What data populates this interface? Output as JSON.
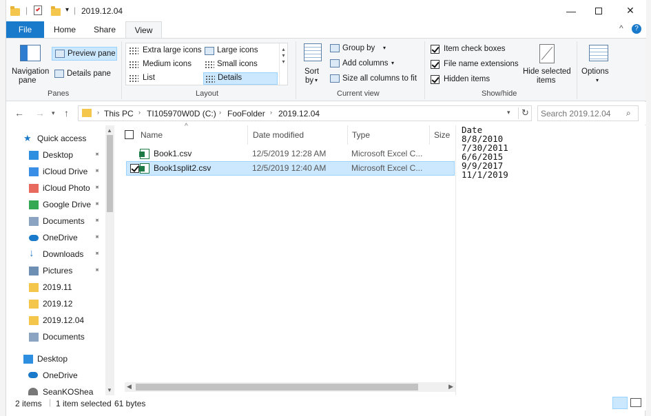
{
  "window": {
    "title": "2019.12.04",
    "qat_dropdown": "▾"
  },
  "tabs": [
    "File",
    "Home",
    "Share",
    "View"
  ],
  "ribbon": {
    "panes": {
      "navigation_pane": "Navigation",
      "navigation_pane_2": "pane",
      "preview_pane": "Preview pane",
      "details_pane": "Details pane",
      "group_label": "Panes"
    },
    "layout": {
      "items": [
        "Extra large icons",
        "Large icons",
        "Medium icons",
        "Small icons",
        "List",
        "Details"
      ],
      "group_label": "Layout"
    },
    "current_view": {
      "sort_by": "Sort",
      "sort_by_2": "by",
      "group_by": "Group by",
      "add_columns": "Add columns",
      "size_all": "Size all columns to fit",
      "group_label": "Current view"
    },
    "show_hide": {
      "item_check_boxes": "Item check boxes",
      "file_name_extensions": "File name extensions",
      "hidden_items": "Hidden items",
      "hide_selected": "Hide selected",
      "hide_selected_2": "items",
      "group_label": "Show/hide"
    },
    "options": "Options"
  },
  "address": {
    "crumbs": [
      "This PC",
      "TI105970W0D (C:)",
      "FooFolder",
      "2019.12.04"
    ],
    "search_placeholder": "Search 2019.12.04"
  },
  "nav": {
    "quick_access": "Quick access",
    "items": [
      {
        "label": "Desktop",
        "icon": "desktop-icon",
        "pinned": true
      },
      {
        "label": "iCloud Drive",
        "icon": "icloud-icon",
        "pinned": true
      },
      {
        "label": "iCloud Photo",
        "icon": "photos-icon",
        "pinned": true
      },
      {
        "label": "Google Drive",
        "icon": "google-drive-icon",
        "pinned": true
      },
      {
        "label": "Documents",
        "icon": "documents-icon",
        "pinned": true
      },
      {
        "label": "OneDrive",
        "icon": "onedrive-icon",
        "pinned": true
      },
      {
        "label": "Downloads",
        "icon": "download-icon",
        "pinned": true
      },
      {
        "label": "Pictures",
        "icon": "pictures-icon",
        "pinned": true
      },
      {
        "label": "2019.11",
        "icon": "folder-icon",
        "pinned": false
      },
      {
        "label": "2019.12",
        "icon": "folder-icon",
        "pinned": false
      },
      {
        "label": "2019.12.04",
        "icon": "folder-icon",
        "pinned": false
      },
      {
        "label": "Documents",
        "icon": "documents-icon",
        "pinned": false
      }
    ],
    "desktop": "Desktop",
    "onedrive": "OneDrive",
    "user": "SeanKOShea"
  },
  "columns": [
    "Name",
    "Date modified",
    "Type",
    "Size"
  ],
  "files": [
    {
      "name": "Book1.csv",
      "modified": "12/5/2019 12:28 AM",
      "type": "Microsoft Excel C...",
      "selected": false
    },
    {
      "name": "Book1split2.csv",
      "modified": "12/5/2019 12:40 AM",
      "type": "Microsoft Excel C...",
      "selected": true
    }
  ],
  "preview": {
    "lines": [
      "Date",
      "8/8/2010",
      "7/30/2011",
      "6/6/2015",
      "9/9/2017",
      "11/1/2019"
    ]
  },
  "status": {
    "count": "2 items",
    "selection": "1 item selected",
    "size": "61 bytes"
  },
  "colors": {
    "accent": "#1979ca",
    "selection": "#cce8ff",
    "folder": "#f5c64c"
  }
}
